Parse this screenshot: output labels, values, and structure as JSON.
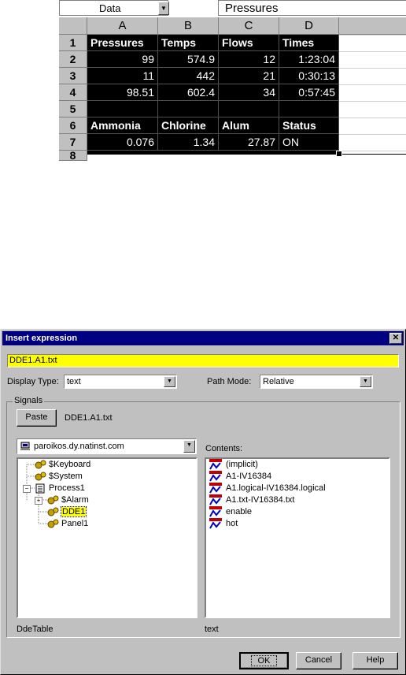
{
  "spreadsheet": {
    "name_box": "Data",
    "formula_bar": "Pressures",
    "columns": [
      "A",
      "B",
      "C",
      "D"
    ],
    "rows": [
      "1",
      "2",
      "3",
      "4",
      "5",
      "6",
      "7",
      "8"
    ],
    "cells": [
      [
        "Pressures",
        "Temps",
        "Flows",
        "Times"
      ],
      [
        "99",
        "574.9",
        "12",
        "1:23:04"
      ],
      [
        "11",
        "442",
        "21",
        "0:30:13"
      ],
      [
        "98.51",
        "602.4",
        "34",
        "0:57:45"
      ],
      [
        "",
        "",
        "",
        ""
      ],
      [
        "Ammonia",
        "Chlorine",
        "Alum",
        "Status"
      ],
      [
        "0.076",
        "1.34",
        "27.87",
        "ON"
      ]
    ]
  },
  "dialog": {
    "title": "Insert expression",
    "expression": "DDE1.A1.txt",
    "display_type_label": "Display Type:",
    "display_type_value": "text",
    "path_mode_label": "Path Mode:",
    "path_mode_value": "Relative",
    "signals_label": "Signals",
    "paste_label": "Paste",
    "paste_target": "DDE1.A1.txt",
    "server": "paroikos.dy.natinst.com",
    "contents_label": "Contents:",
    "tree": [
      "$Keyboard",
      "$System",
      "Process1",
      "$Alarm",
      "DDE1",
      "Panel1"
    ],
    "contents": [
      "(implicit)",
      "A1-IV16384",
      "A1.logical-IV16384.logical",
      "A1.txt-IV16384.txt",
      "enable",
      "hot"
    ],
    "tree_status": "DdeTable",
    "contents_status": "text",
    "ok_label": "OK",
    "cancel_label": "Cancel",
    "help_label": "Help"
  },
  "colors": {
    "titlebar": "#000080",
    "highlight": "#ffff00",
    "dialog_face": "#c0c0c0"
  }
}
